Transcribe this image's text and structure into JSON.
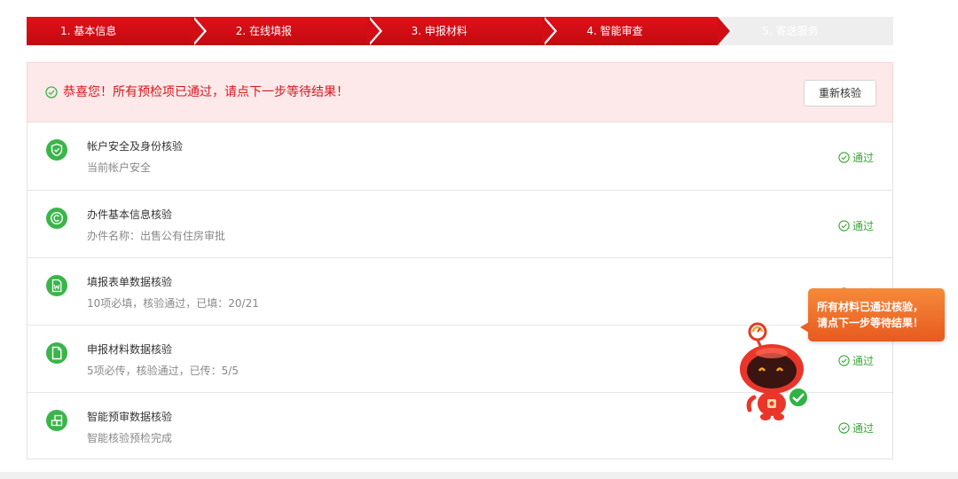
{
  "steps": [
    {
      "label": "1. 基本信息",
      "state": "done"
    },
    {
      "label": "2. 在线填报",
      "state": "done"
    },
    {
      "label": "3. 申报材料",
      "state": "done"
    },
    {
      "label": "4. 智能审查",
      "state": "done"
    },
    {
      "label": "5. 寄送服务",
      "state": "pending"
    }
  ],
  "banner": {
    "message": "恭喜您！所有预检项已通过，请点下一步等待结果！",
    "recheck_label": "重新核验"
  },
  "checks": [
    {
      "title": "帐户安全及身份核验",
      "desc": "当前帐户安全",
      "status": "通过",
      "icon": "shield-check-icon"
    },
    {
      "title": "办件基本信息核验",
      "desc": "办件名称：出售公有住房审批",
      "status": "通过",
      "icon": "copyright-icon"
    },
    {
      "title": "填报表单数据核验",
      "desc": "10项必填，核验通过，已填：20/21",
      "status": "通过",
      "icon": "word-document-icon"
    },
    {
      "title": "申报材料数据核验",
      "desc": "5项必传，核验通过，已传：5/5",
      "status": "通过",
      "icon": "file-icon"
    },
    {
      "title": "智能预审数据核验",
      "desc": "智能核验预检完成",
      "status": "通过",
      "icon": "blocks-icon"
    }
  ],
  "assistant": {
    "bubble_line1": "所有材料已通过核验，",
    "bubble_line2": "请点下一步等待结果！"
  },
  "colors": {
    "accent_red": "#d20d15",
    "success_green": "#3ab54a",
    "banner_bg": "#fde9e9",
    "bubble_orange": "#ee6d27"
  }
}
